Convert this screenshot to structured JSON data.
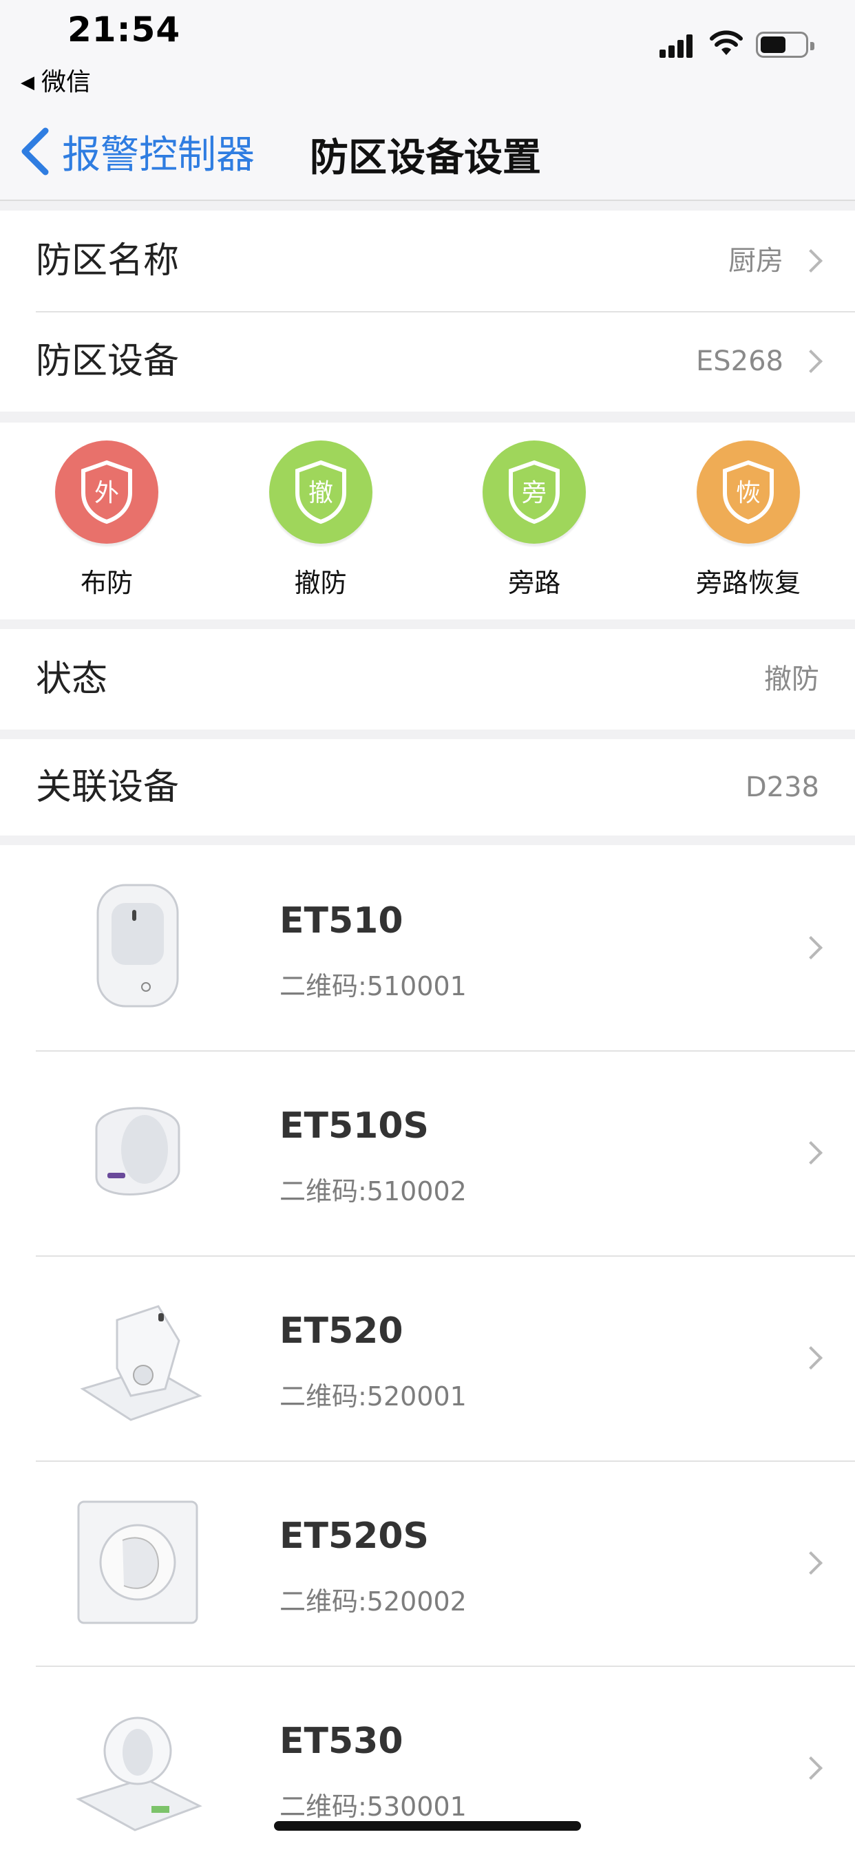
{
  "status_bar": {
    "time": "21:54",
    "back_app": "微信"
  },
  "nav": {
    "back_label": "报警控制器",
    "title": "防区设备设置"
  },
  "zone": {
    "name_label": "防区名称",
    "name_value": "厨房",
    "device_label": "防区设备",
    "device_value": "ES268"
  },
  "actions": [
    {
      "glyph": "外",
      "label": "布防",
      "color": "#e8716b"
    },
    {
      "glyph": "撤",
      "label": "撤防",
      "color": "#9fd65b"
    },
    {
      "glyph": "旁",
      "label": "旁路",
      "color": "#9fd65b"
    },
    {
      "glyph": "恢",
      "label": "旁路恢复",
      "color": "#efac55"
    }
  ],
  "state": {
    "label": "状态",
    "value": "撤防"
  },
  "linked": {
    "label": "关联设备",
    "value": "D238"
  },
  "devices": [
    {
      "name": "ET510",
      "code": "二维码:510001"
    },
    {
      "name": "ET510S",
      "code": "二维码:510002"
    },
    {
      "name": "ET520",
      "code": "二维码:520001"
    },
    {
      "name": "ET520S",
      "code": "二维码:520002"
    },
    {
      "name": "ET530",
      "code": "二维码:530001"
    }
  ]
}
